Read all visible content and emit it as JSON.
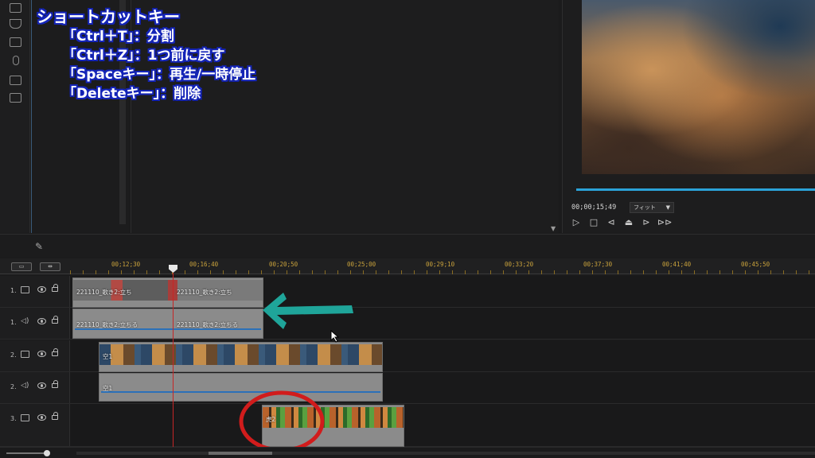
{
  "shortcuts": {
    "title": "ショートカットキー",
    "lines": [
      "「Ctrl＋T」：分割",
      "「Ctrl＋Z」：1つ前に戻す",
      "「Spaceキー」：再生/一時停止",
      "「Deleteキー」：削除"
    ]
  },
  "preview": {
    "timecode": "00;00;15;49",
    "fit_label": "フィット",
    "controls": [
      "play-icon",
      "stop-icon",
      "prev-frame-icon",
      "snapshot-icon",
      "next-frame-icon",
      "fast-forward-icon"
    ]
  },
  "ruler": {
    "labels": [
      "00;12;30",
      "00;16;40",
      "00;20;50",
      "00;25;00",
      "00;29;10",
      "00;33;20",
      "00;37;30",
      "00;41;40",
      "00;45;50"
    ]
  },
  "tracks": [
    {
      "num": "1.",
      "type": "video"
    },
    {
      "num": "1.",
      "type": "audio"
    },
    {
      "num": "2.",
      "type": "video"
    },
    {
      "num": "2.",
      "type": "audio"
    },
    {
      "num": "3.",
      "type": "video"
    }
  ],
  "clips": {
    "t1_video_a": "221110_歌き2:立ち",
    "t1_video_b": "221110_歌き2:立ち",
    "t1_audio_a": "221110_歌き2:立ちる",
    "t1_audio_b": "221110_歌き2:立ちる",
    "t2_video": "空1",
    "t2_audio": "空1",
    "t3_video": "虎2"
  },
  "colors": {
    "accent": "#2ba3d9",
    "playhead": "#c62626",
    "ruler_text": "#c9a23c",
    "arrow": "#1fa59a",
    "highlight_circle": "#d11c1c"
  }
}
